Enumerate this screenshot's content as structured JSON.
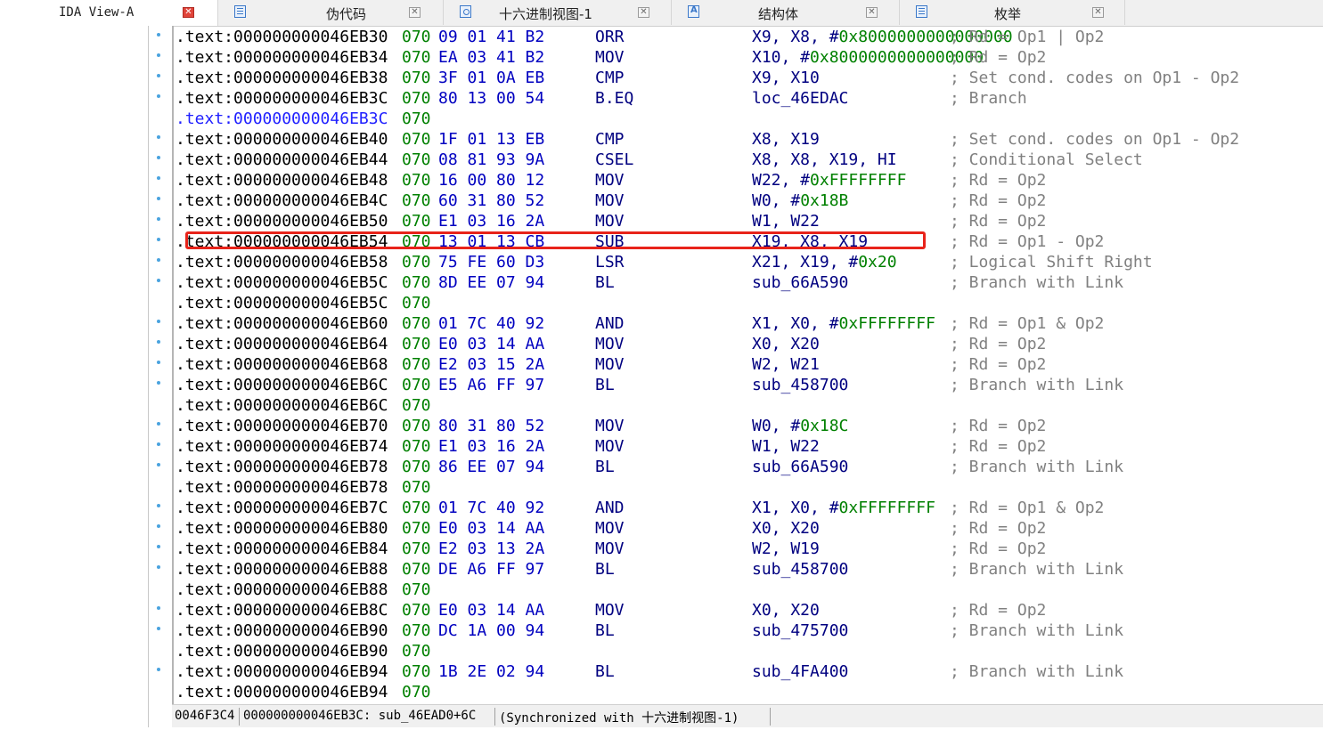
{
  "tabs": [
    {
      "label": "IDA View-A",
      "icon": "disassembly-icon",
      "close": "close-icon",
      "active": true
    },
    {
      "label": "伪代码",
      "icon": "pseudocode-icon",
      "close": "close-icon",
      "active": false
    },
    {
      "label": "十六进制视图-1",
      "icon": "hex-view-icon",
      "close": "close-icon",
      "active": false
    },
    {
      "label": "结构体",
      "icon": "structures-icon",
      "close": "close-icon",
      "active": false
    },
    {
      "label": "枚举",
      "icon": "enums-icon",
      "close": "close-icon",
      "active": false
    }
  ],
  "close_glyph": "✕",
  "lines": [
    {
      "addr": ".text:000000000046EB30",
      "seg": "070",
      "bytes": "09 01 41 B2",
      "mn": "ORR",
      "op": "X9, X8, #",
      "imm": "0x8000000000000000",
      "cm": "; Rd = Op1 | Op2",
      "dot": true
    },
    {
      "addr": ".text:000000000046EB34",
      "seg": "070",
      "bytes": "EA 03 41 B2",
      "mn": "MOV",
      "op": "X10, #",
      "imm": "0x8000000000000000",
      "cm": "; Rd = Op2",
      "dot": true
    },
    {
      "addr": ".text:000000000046EB38",
      "seg": "070",
      "bytes": "3F 01 0A EB",
      "mn": "CMP",
      "op": "X9, X10",
      "imm": "",
      "cm": "; Set cond. codes on Op1 - Op2",
      "dot": true
    },
    {
      "addr": ".text:000000000046EB3C",
      "seg": "070",
      "bytes": "80 13 00 54",
      "mn": "B.EQ",
      "op": "loc_46EDAC",
      "imm": "",
      "cm": "; Branch",
      "dot": true
    },
    {
      "addr": ".text:000000000046EB3C",
      "seg": "070",
      "bytes": "",
      "mn": "",
      "op": "",
      "imm": "",
      "cm": "",
      "dot": false,
      "current": true
    },
    {
      "addr": ".text:000000000046EB40",
      "seg": "070",
      "bytes": "1F 01 13 EB",
      "mn": "CMP",
      "op": "X8, X19",
      "imm": "",
      "cm": "; Set cond. codes on Op1 - Op2",
      "dot": true
    },
    {
      "addr": ".text:000000000046EB44",
      "seg": "070",
      "bytes": "08 81 93 9A",
      "mn": "CSEL",
      "op": "X8, X8, X19, HI",
      "imm": "",
      "cm": "; Conditional Select",
      "dot": true
    },
    {
      "addr": ".text:000000000046EB48",
      "seg": "070",
      "bytes": "16 00 80 12",
      "mn": "MOV",
      "op": "W22, #",
      "imm": "0xFFFFFFFF",
      "cm": "; Rd = Op2",
      "dot": true
    },
    {
      "addr": ".text:000000000046EB4C",
      "seg": "070",
      "bytes": "60 31 80 52",
      "mn": "MOV",
      "op": "W0, #",
      "imm": "0x18B",
      "cm": "; Rd = Op2",
      "dot": true
    },
    {
      "addr": ".text:000000000046EB50",
      "seg": "070",
      "bytes": "E1 03 16 2A",
      "mn": "MOV",
      "op": "W1, W22",
      "imm": "",
      "cm": "; Rd = Op2",
      "dot": true
    },
    {
      "addr": ".text:000000000046EB54",
      "seg": "070",
      "bytes": "13 01 13 CB",
      "mn": "SUB",
      "op": "X19, X8, X19",
      "imm": "",
      "cm": "; Rd = Op1 - Op2",
      "dot": true,
      "highlight": true
    },
    {
      "addr": ".text:000000000046EB58",
      "seg": "070",
      "bytes": "75 FE 60 D3",
      "mn": "LSR",
      "op": "X21, X19, #",
      "imm": "0x20",
      "cm": "; Logical Shift Right",
      "dot": true
    },
    {
      "addr": ".text:000000000046EB5C",
      "seg": "070",
      "bytes": "8D EE 07 94",
      "mn": "BL",
      "op": "sub_66A590",
      "imm": "",
      "cm": "; Branch with Link",
      "dot": true
    },
    {
      "addr": ".text:000000000046EB5C",
      "seg": "070",
      "bytes": "",
      "mn": "",
      "op": "",
      "imm": "",
      "cm": "",
      "dot": false
    },
    {
      "addr": ".text:000000000046EB60",
      "seg": "070",
      "bytes": "01 7C 40 92",
      "mn": "AND",
      "op": "X1, X0, #",
      "imm": "0xFFFFFFFF",
      "cm": "; Rd = Op1 & Op2",
      "dot": true
    },
    {
      "addr": ".text:000000000046EB64",
      "seg": "070",
      "bytes": "E0 03 14 AA",
      "mn": "MOV",
      "op": "X0, X20",
      "imm": "",
      "cm": "; Rd = Op2",
      "dot": true
    },
    {
      "addr": ".text:000000000046EB68",
      "seg": "070",
      "bytes": "E2 03 15 2A",
      "mn": "MOV",
      "op": "W2, W21",
      "imm": "",
      "cm": "; Rd = Op2",
      "dot": true
    },
    {
      "addr": ".text:000000000046EB6C",
      "seg": "070",
      "bytes": "E5 A6 FF 97",
      "mn": "BL",
      "op": "sub_458700",
      "imm": "",
      "cm": "; Branch with Link",
      "dot": true
    },
    {
      "addr": ".text:000000000046EB6C",
      "seg": "070",
      "bytes": "",
      "mn": "",
      "op": "",
      "imm": "",
      "cm": "",
      "dot": false
    },
    {
      "addr": ".text:000000000046EB70",
      "seg": "070",
      "bytes": "80 31 80 52",
      "mn": "MOV",
      "op": "W0, #",
      "imm": "0x18C",
      "cm": "; Rd = Op2",
      "dot": true
    },
    {
      "addr": ".text:000000000046EB74",
      "seg": "070",
      "bytes": "E1 03 16 2A",
      "mn": "MOV",
      "op": "W1, W22",
      "imm": "",
      "cm": "; Rd = Op2",
      "dot": true
    },
    {
      "addr": ".text:000000000046EB78",
      "seg": "070",
      "bytes": "86 EE 07 94",
      "mn": "BL",
      "op": "sub_66A590",
      "imm": "",
      "cm": "; Branch with Link",
      "dot": true
    },
    {
      "addr": ".text:000000000046EB78",
      "seg": "070",
      "bytes": "",
      "mn": "",
      "op": "",
      "imm": "",
      "cm": "",
      "dot": false
    },
    {
      "addr": ".text:000000000046EB7C",
      "seg": "070",
      "bytes": "01 7C 40 92",
      "mn": "AND",
      "op": "X1, X0, #",
      "imm": "0xFFFFFFFF",
      "cm": "; Rd = Op1 & Op2",
      "dot": true
    },
    {
      "addr": ".text:000000000046EB80",
      "seg": "070",
      "bytes": "E0 03 14 AA",
      "mn": "MOV",
      "op": "X0, X20",
      "imm": "",
      "cm": "; Rd = Op2",
      "dot": true
    },
    {
      "addr": ".text:000000000046EB84",
      "seg": "070",
      "bytes": "E2 03 13 2A",
      "mn": "MOV",
      "op": "W2, W19",
      "imm": "",
      "cm": "; Rd = Op2",
      "dot": true
    },
    {
      "addr": ".text:000000000046EB88",
      "seg": "070",
      "bytes": "DE A6 FF 97",
      "mn": "BL",
      "op": "sub_458700",
      "imm": "",
      "cm": "; Branch with Link",
      "dot": true
    },
    {
      "addr": ".text:000000000046EB88",
      "seg": "070",
      "bytes": "",
      "mn": "",
      "op": "",
      "imm": "",
      "cm": "",
      "dot": false
    },
    {
      "addr": ".text:000000000046EB8C",
      "seg": "070",
      "bytes": "E0 03 14 AA",
      "mn": "MOV",
      "op": "X0, X20",
      "imm": "",
      "cm": "; Rd = Op2",
      "dot": true
    },
    {
      "addr": ".text:000000000046EB90",
      "seg": "070",
      "bytes": "DC 1A 00 94",
      "mn": "BL",
      "op": "sub_475700",
      "imm": "",
      "cm": "; Branch with Link",
      "dot": true
    },
    {
      "addr": ".text:000000000046EB90",
      "seg": "070",
      "bytes": "",
      "mn": "",
      "op": "",
      "imm": "",
      "cm": "",
      "dot": false
    },
    {
      "addr": ".text:000000000046EB94",
      "seg": "070",
      "bytes": "1B 2E 02 94",
      "mn": "BL",
      "op": "sub_4FA400",
      "imm": "",
      "cm": "; Branch with Link",
      "dot": true
    },
    {
      "addr": ".text:000000000046EB94",
      "seg": "070",
      "bytes": "",
      "mn": "",
      "op": "",
      "imm": "",
      "cm": "",
      "dot": false
    }
  ],
  "status": {
    "offset": "0046F3C4",
    "location": "000000000046EB3C: sub_46EAD0+6C",
    "sync": "(Synchronized with 十六进制视图-1)"
  },
  "colors": {
    "highlight_box": "#e8231a",
    "immediate": "#008000",
    "bytes": "#0000c0",
    "comment": "#808080",
    "current_line": "#2020ff"
  }
}
